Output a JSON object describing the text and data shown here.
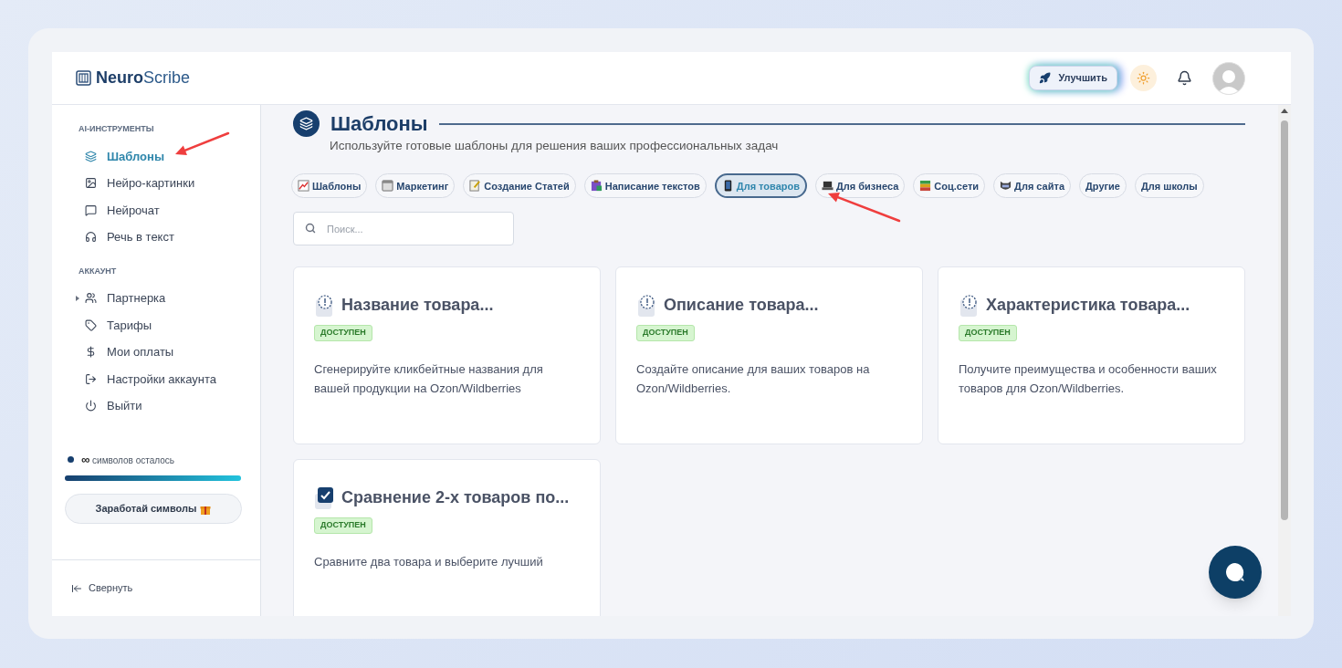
{
  "brand": {
    "bold": "Neuro",
    "light": "Scribe"
  },
  "header": {
    "upgrade_label": "Улучшить"
  },
  "sidebar": {
    "sections": [
      {
        "title": "AI-ИНСТРУМЕНТЫ",
        "items": [
          {
            "label": "Шаблоны",
            "kind": "layers",
            "selected": true
          },
          {
            "label": "Нейро-картинки",
            "kind": "image",
            "selected": false
          },
          {
            "label": "Нейрочат",
            "kind": "chat",
            "selected": false
          },
          {
            "label": "Речь в текст",
            "kind": "headphones",
            "selected": false
          }
        ]
      },
      {
        "title": "АККАУНТ",
        "items": [
          {
            "label": "Партнерка",
            "kind": "users",
            "selected": false,
            "expanded": false
          },
          {
            "label": "Тарифы",
            "kind": "tag",
            "selected": false
          },
          {
            "label": "Мои оплаты",
            "kind": "dollar",
            "selected": false
          },
          {
            "label": "Настройки аккаунта",
            "kind": "logout",
            "selected": false
          },
          {
            "label": "Выйти",
            "kind": "power",
            "selected": false
          }
        ]
      }
    ],
    "quota": {
      "amount": "∞",
      "label": "символов осталось",
      "level": 1
    },
    "earn_button": "Заработай символы",
    "collapse_label": "Свернуть"
  },
  "page": {
    "title": "Шаблоны",
    "subtitle": "Используйте готовые шаблоны для решения ваших профессиональных задач"
  },
  "filters": [
    {
      "label": "Шаблоны",
      "kind": "chart",
      "selected": false
    },
    {
      "label": "Маркетинг",
      "kind": "calendar",
      "selected": false
    },
    {
      "label": "Создание Статей",
      "kind": "memo",
      "selected": false
    },
    {
      "label": "Написание текстов",
      "kind": "clipboard",
      "selected": false
    },
    {
      "label": "Для товаров",
      "kind": "phone",
      "selected": true
    },
    {
      "label": "Для бизнеса",
      "kind": "laptop",
      "selected": false
    },
    {
      "label": "Соц.сети",
      "kind": "books",
      "selected": false
    },
    {
      "label": "Для сайта",
      "kind": "mask",
      "selected": false
    },
    {
      "label": "Другие",
      "kind": "plain",
      "selected": false
    },
    {
      "label": "Для школы",
      "kind": "plain",
      "selected": false
    }
  ],
  "search": {
    "placeholder": "Поиск..."
  },
  "cards": [
    {
      "kind": "notice",
      "title": "Название товара...",
      "badge": "ДОСТУПЕН",
      "description": "Сгенерируйте кликбейтные названия для вашей продукции на Ozon/Wildberries"
    },
    {
      "kind": "notice",
      "title": "Описание товара...",
      "badge": "ДОСТУПЕН",
      "description": "Создайте описание для ваших товаров на Ozon/Wildberries."
    },
    {
      "kind": "notice",
      "title": "Характеристика товара...",
      "badge": "ДОСТУПЕН",
      "description": "Получите преимущества и особенности ваших товаров для Ozon/Wildberries."
    },
    {
      "kind": "checklist",
      "title": "Сравнение 2-х товаров по...",
      "badge": "ДОСТУПЕН",
      "description": "Сравните два товара и выберите лучший"
    }
  ]
}
